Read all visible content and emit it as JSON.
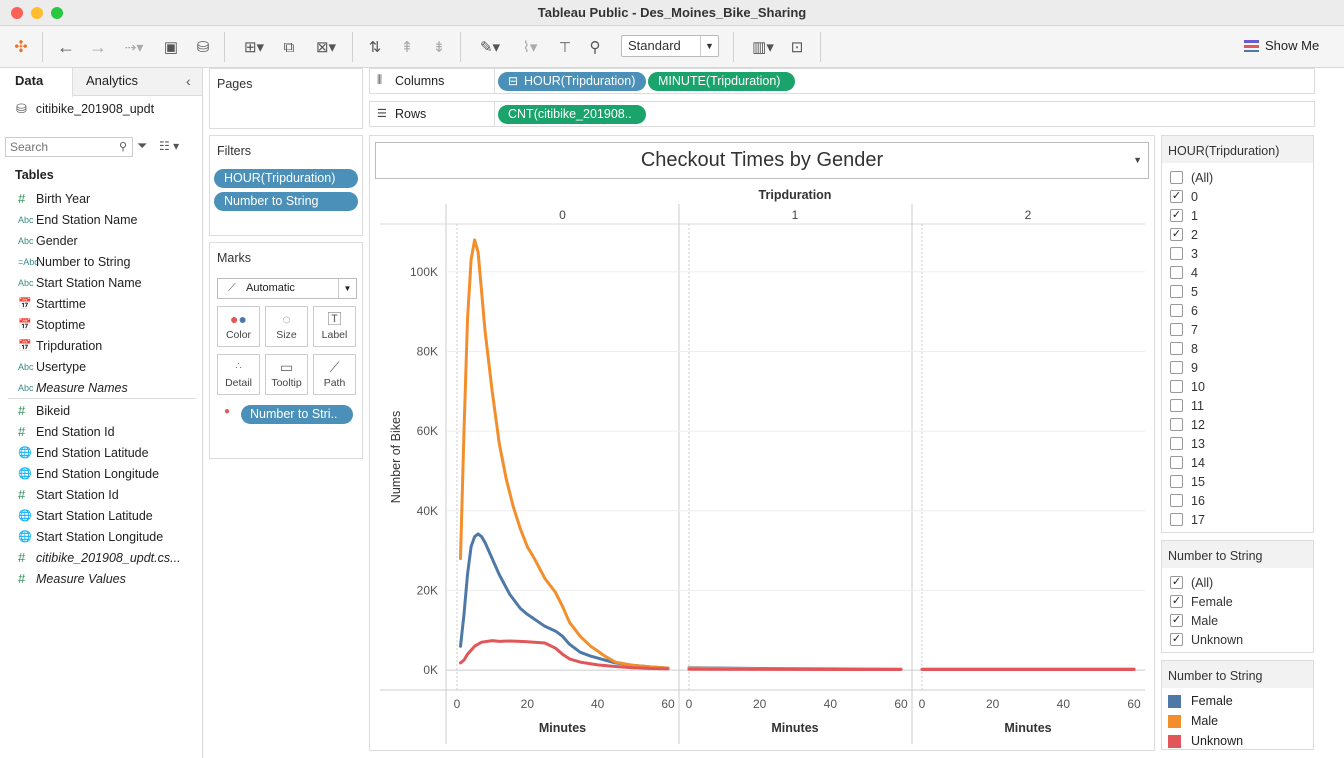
{
  "window": {
    "title": "Tableau Public - Des_Moines_Bike_Sharing"
  },
  "toolbar": {
    "view_mode": "Standard",
    "show_me": "Show Me"
  },
  "left_panel": {
    "tabs": [
      "Data",
      "Analytics"
    ],
    "datasource": "citibike_201908_updt",
    "search_placeholder": "Search",
    "tables_header": "Tables",
    "dimensions": [
      {
        "icon": "#",
        "label": "Birth Year"
      },
      {
        "icon": "Abc",
        "label": "End Station Name"
      },
      {
        "icon": "Abc",
        "label": "Gender"
      },
      {
        "icon": "=Abc",
        "label": "Number to String"
      },
      {
        "icon": "Abc",
        "label": "Start Station Name"
      },
      {
        "icon": "date",
        "label": "Starttime"
      },
      {
        "icon": "date",
        "label": "Stoptime"
      },
      {
        "icon": "date",
        "label": "Tripduration"
      },
      {
        "icon": "Abc",
        "label": "Usertype"
      },
      {
        "icon": "Abc",
        "label": "Measure Names"
      }
    ],
    "measures": [
      {
        "icon": "#",
        "label": "Bikeid"
      },
      {
        "icon": "#",
        "label": "End Station Id"
      },
      {
        "icon": "geo",
        "label": "End Station Latitude"
      },
      {
        "icon": "geo",
        "label": "End Station Longitude"
      },
      {
        "icon": "#",
        "label": "Start Station Id"
      },
      {
        "icon": "geo",
        "label": "Start Station Latitude"
      },
      {
        "icon": "geo",
        "label": "Start Station Longitude"
      },
      {
        "icon": "#",
        "label": "citibike_201908_updt.cs..."
      },
      {
        "icon": "#",
        "label": "Measure Values"
      }
    ]
  },
  "cards": {
    "pages": "Pages",
    "filters": "Filters",
    "filter_pills": [
      "HOUR(Tripduration)",
      "Number to String"
    ],
    "marks": "Marks",
    "mark_type": "Automatic",
    "mark_buttons": [
      "Color",
      "Size",
      "Label",
      "Detail",
      "Tooltip",
      "Path"
    ],
    "color_pill": "Number to Stri.."
  },
  "shelves": {
    "columns_label": "Columns",
    "rows_label": "Rows",
    "column_pills": [
      "HOUR(Tripduration)",
      "MINUTE(Tripduration)"
    ],
    "row_pills": [
      "CNT(citibike_201908.."
    ]
  },
  "hour_filter": {
    "title": "HOUR(Tripduration)",
    "items": [
      {
        "label": "(All)",
        "checked": false
      },
      {
        "label": "0",
        "checked": true
      },
      {
        "label": "1",
        "checked": true
      },
      {
        "label": "2",
        "checked": true
      },
      {
        "label": "3",
        "checked": false
      },
      {
        "label": "4",
        "checked": false
      },
      {
        "label": "5",
        "checked": false
      },
      {
        "label": "6",
        "checked": false
      },
      {
        "label": "7",
        "checked": false
      },
      {
        "label": "8",
        "checked": false
      },
      {
        "label": "9",
        "checked": false
      },
      {
        "label": "10",
        "checked": false
      },
      {
        "label": "11",
        "checked": false
      },
      {
        "label": "12",
        "checked": false
      },
      {
        "label": "13",
        "checked": false
      },
      {
        "label": "14",
        "checked": false
      },
      {
        "label": "15",
        "checked": false
      },
      {
        "label": "16",
        "checked": false
      },
      {
        "label": "17",
        "checked": false
      }
    ]
  },
  "gender_filter": {
    "title": "Number to String",
    "items": [
      {
        "label": "(All)",
        "checked": true
      },
      {
        "label": "Female",
        "checked": true
      },
      {
        "label": "Male",
        "checked": true
      },
      {
        "label": "Unknown",
        "checked": true
      }
    ]
  },
  "legend": {
    "title": "Number to String",
    "items": [
      {
        "label": "Female",
        "color": "#4e79a7"
      },
      {
        "label": "Male",
        "color": "#f28e2b"
      },
      {
        "label": "Unknown",
        "color": "#e15759"
      }
    ]
  },
  "chart_data": {
    "type": "line",
    "title": "Checkout Times by Gender",
    "column_header": "Tripduration",
    "panels": [
      "0",
      "1",
      "2"
    ],
    "xlabel": "Minutes",
    "ylabel": "Number of Bikes",
    "xlim": [
      0,
      60
    ],
    "ylim": [
      -5000,
      112000
    ],
    "y_ticks": [
      "0K",
      "20K",
      "40K",
      "60K",
      "80K",
      "100K"
    ],
    "y_tick_values": [
      0,
      20000,
      40000,
      60000,
      80000,
      100000
    ],
    "x_ticks": [
      0,
      20,
      40,
      60
    ],
    "grid": true,
    "series": [
      {
        "name": "Female",
        "color": "#4e79a7",
        "panel0": [
          [
            1,
            6000
          ],
          [
            2,
            14000
          ],
          [
            3,
            24000
          ],
          [
            4,
            31000
          ],
          [
            5,
            33500
          ],
          [
            6,
            34200
          ],
          [
            7,
            33500
          ],
          [
            8,
            32000
          ],
          [
            10,
            28000
          ],
          [
            12,
            24000
          ],
          [
            15,
            19000
          ],
          [
            18,
            15500
          ],
          [
            20,
            14000
          ],
          [
            22,
            12800
          ],
          [
            25,
            11000
          ],
          [
            28,
            9800
          ],
          [
            30,
            8500
          ],
          [
            32,
            6500
          ],
          [
            35,
            4500
          ],
          [
            38,
            3500
          ],
          [
            40,
            3000
          ],
          [
            45,
            1800
          ],
          [
            50,
            1200
          ],
          [
            55,
            800
          ],
          [
            60,
            500
          ]
        ],
        "panel1": [
          [
            0,
            600
          ],
          [
            20,
            400
          ],
          [
            40,
            300
          ],
          [
            60,
            200
          ]
        ],
        "panel2": [
          [
            0,
            200
          ],
          [
            20,
            200
          ],
          [
            40,
            200
          ],
          [
            60,
            200
          ]
        ]
      },
      {
        "name": "Male",
        "color": "#f28e2b",
        "panel0": [
          [
            1,
            28000
          ],
          [
            2,
            60000
          ],
          [
            3,
            88000
          ],
          [
            4,
            103000
          ],
          [
            5,
            108000
          ],
          [
            6,
            105000
          ],
          [
            7,
            95000
          ],
          [
            8,
            85000
          ],
          [
            10,
            70000
          ],
          [
            12,
            57000
          ],
          [
            14,
            48000
          ],
          [
            16,
            41000
          ],
          [
            18,
            35500
          ],
          [
            20,
            31000
          ],
          [
            22,
            28000
          ],
          [
            25,
            23000
          ],
          [
            28,
            19500
          ],
          [
            30,
            16000
          ],
          [
            32,
            12000
          ],
          [
            35,
            8500
          ],
          [
            38,
            6000
          ],
          [
            40,
            4800
          ],
          [
            42,
            3500
          ],
          [
            45,
            2000
          ],
          [
            50,
            1200
          ],
          [
            55,
            800
          ],
          [
            60,
            500
          ]
        ],
        "panel1": [
          [
            0,
            500
          ],
          [
            20,
            300
          ],
          [
            40,
            200
          ],
          [
            60,
            200
          ]
        ],
        "panel2": [
          [
            0,
            200
          ],
          [
            20,
            200
          ],
          [
            40,
            200
          ],
          [
            60,
            200
          ]
        ]
      },
      {
        "name": "Unknown",
        "color": "#e15759",
        "panel0": [
          [
            1,
            1800
          ],
          [
            2,
            2500
          ],
          [
            3,
            4000
          ],
          [
            5,
            6000
          ],
          [
            7,
            7000
          ],
          [
            10,
            7400
          ],
          [
            12,
            7200
          ],
          [
            15,
            7300
          ],
          [
            18,
            7200
          ],
          [
            20,
            7100
          ],
          [
            25,
            6800
          ],
          [
            28,
            5500
          ],
          [
            30,
            4000
          ],
          [
            32,
            2800
          ],
          [
            35,
            2000
          ],
          [
            40,
            1300
          ],
          [
            45,
            900
          ],
          [
            50,
            600
          ],
          [
            55,
            400
          ],
          [
            60,
            300
          ]
        ],
        "panel1": [
          [
            0,
            200
          ],
          [
            60,
            150
          ]
        ],
        "panel2": [
          [
            0,
            150
          ],
          [
            60,
            150
          ]
        ]
      }
    ]
  }
}
